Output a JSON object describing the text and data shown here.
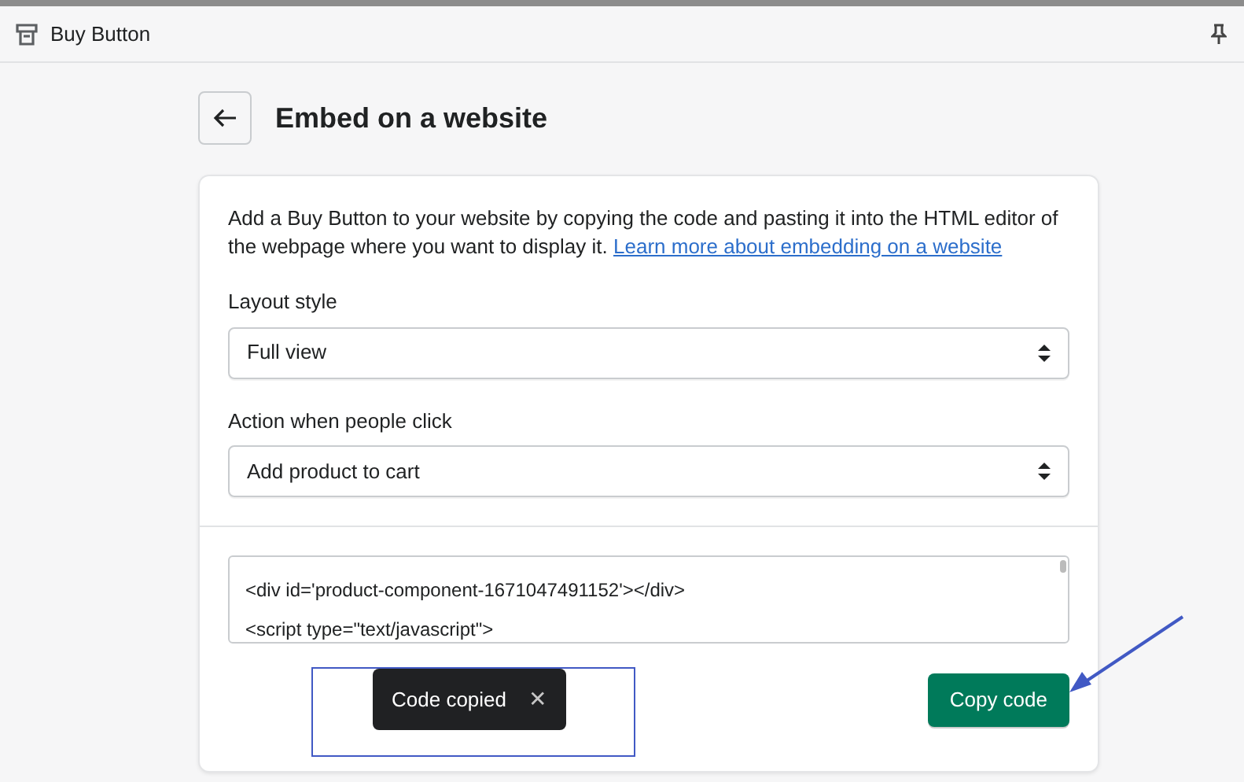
{
  "header": {
    "title": "Buy Button"
  },
  "page": {
    "title": "Embed on a website"
  },
  "intro": {
    "text": "Add a Buy Button to your website by copying the code and pasting it into the HTML editor of the webpage where you want to display it.",
    "link": "Learn more about embedding on a website"
  },
  "fields": [
    {
      "label": "Layout style",
      "value": "Full view"
    },
    {
      "label": "Action when people click",
      "value": "Add product to cart"
    }
  ],
  "code": {
    "lines": [
      "<div id='product-component-1671047491152'></div>",
      "<script type=\"text/javascript\">"
    ]
  },
  "toast": {
    "text": "Code copied",
    "close": "✕"
  },
  "copy_button": {
    "label": "Copy code"
  }
}
